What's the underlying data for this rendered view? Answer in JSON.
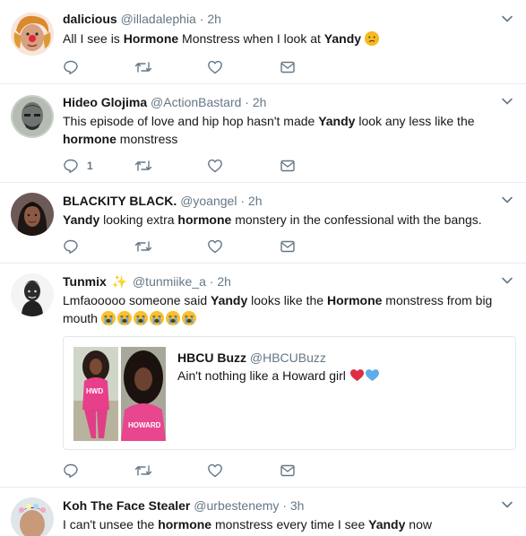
{
  "colors": {
    "icon_gray": "#657786",
    "border": "#e6ecf0",
    "text": "#14171a",
    "heart_red": "#e0245e",
    "heart_blue": "#5dadec"
  },
  "tweets": [
    {
      "name": "dalicious",
      "handle": "@illadalephia",
      "sep": "·",
      "time": "2h",
      "text": [
        {
          "t": "All I see is ",
          "b": false
        },
        {
          "t": "Hormone",
          "b": true
        },
        {
          "t": " Monstress when I look at ",
          "b": false
        },
        {
          "t": "Yandy",
          "b": true
        },
        {
          "t": " ",
          "b": false
        }
      ],
      "reply_count": ""
    },
    {
      "name": "Hideo Glojima",
      "handle": "@ActionBastard",
      "sep": "·",
      "time": "2h",
      "text": [
        {
          "t": "This episode of love and hip hop hasn't made ",
          "b": false
        },
        {
          "t": "Yandy",
          "b": true
        },
        {
          "t": " look any less like the ",
          "b": false
        },
        {
          "t": "hormone",
          "b": true
        },
        {
          "t": " monstress",
          "b": false
        }
      ],
      "reply_count": "1"
    },
    {
      "name": "BLACKITY BLACK.",
      "handle": "@yoangel",
      "sep": "·",
      "time": "2h",
      "text": [
        {
          "t": "Yandy",
          "b": true
        },
        {
          "t": " looking extra ",
          "b": false
        },
        {
          "t": "hormone",
          "b": true
        },
        {
          "t": " monstery in the confessional with the bangs.",
          "b": false
        }
      ],
      "reply_count": ""
    },
    {
      "name": "Tunmix",
      "handle": "@tunmiike_a",
      "sep": "·",
      "time": "2h",
      "text": [
        {
          "t": "Lmfaooooo someone said ",
          "b": false
        },
        {
          "t": "Yandy",
          "b": true
        },
        {
          "t": " looks like the ",
          "b": false
        },
        {
          "t": "Hormone",
          "b": true
        },
        {
          "t": " monstress from big mouth ",
          "b": false
        }
      ],
      "reply_count": "",
      "quoted": {
        "name": "HBCU Buzz",
        "handle": "@HBCUBuzz",
        "text": "Ain't nothing like a Howard girl "
      }
    },
    {
      "name": "Koh The Face Stealer",
      "handle": "@urbestenemy",
      "sep": "·",
      "time": "3h",
      "text": [
        {
          "t": "I can't unsee the ",
          "b": false
        },
        {
          "t": "hormone",
          "b": true
        },
        {
          "t": " monstress every time I see ",
          "b": false
        },
        {
          "t": "Yandy",
          "b": true
        },
        {
          "t": " now",
          "b": false
        }
      ],
      "reply_count": ""
    }
  ]
}
